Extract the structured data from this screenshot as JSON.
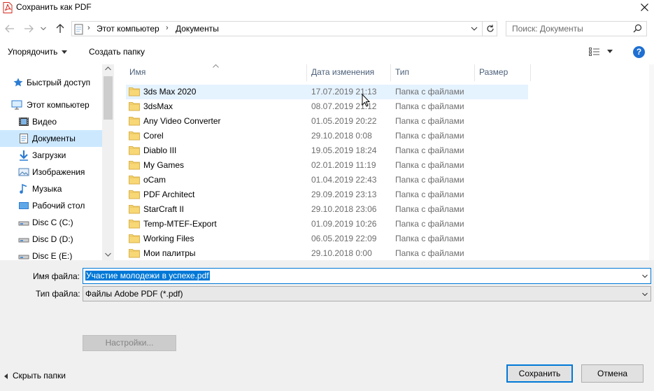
{
  "window": {
    "title": "Сохранить как PDF",
    "close_glyph": "✕"
  },
  "address": {
    "crumbs": [
      "Этот компьютер",
      "Документы"
    ],
    "separator": "›"
  },
  "search": {
    "placeholder": "Поиск: Документы"
  },
  "toolbar": {
    "organize": "Упорядочить",
    "new_folder": "Создать папку",
    "help": "?"
  },
  "sidebar": {
    "items": [
      {
        "label": "Быстрый доступ",
        "icon": "star-icon"
      },
      {
        "label": "Этот компьютер",
        "icon": "computer-icon"
      },
      {
        "label": "Видео",
        "icon": "video-icon"
      },
      {
        "label": "Документы",
        "icon": "documents-icon",
        "selected": true
      },
      {
        "label": "Загрузки",
        "icon": "download-icon"
      },
      {
        "label": "Изображения",
        "icon": "pictures-icon"
      },
      {
        "label": "Музыка",
        "icon": "music-icon"
      },
      {
        "label": "Рабочий стол",
        "icon": "desktop-icon"
      },
      {
        "label": "Disc C (C:)",
        "icon": "drive-icon"
      },
      {
        "label": "Disc D (D:)",
        "icon": "drive-icon"
      },
      {
        "label": "Disc E (E:)",
        "icon": "drive-icon"
      }
    ]
  },
  "columns": {
    "name": "Имя",
    "date": "Дата изменения",
    "type": "Тип",
    "size": "Размер"
  },
  "files": [
    {
      "name": "3ds Max 2020",
      "date": "17.07.2019 21:13",
      "type": "Папка с файлами"
    },
    {
      "name": "3dsMax",
      "date": "08.07.2019 21:12",
      "type": "Папка с файлами"
    },
    {
      "name": "Any Video Converter",
      "date": "01.05.2019 20:22",
      "type": "Папка с файлами"
    },
    {
      "name": "Corel",
      "date": "29.10.2018 0:08",
      "type": "Папка с файлами"
    },
    {
      "name": "Diablo III",
      "date": "19.05.2019 18:24",
      "type": "Папка с файлами"
    },
    {
      "name": "My Games",
      "date": "02.01.2019 11:19",
      "type": "Папка с файлами"
    },
    {
      "name": "oCam",
      "date": "01.04.2019 22:43",
      "type": "Папка с файлами"
    },
    {
      "name": "PDF Architect",
      "date": "29.09.2019 23:13",
      "type": "Папка с файлами"
    },
    {
      "name": "StarCraft II",
      "date": "29.10.2018 23:06",
      "type": "Папка с файлами"
    },
    {
      "name": "Temp-MTEF-Export",
      "date": "01.09.2019 10:26",
      "type": "Папка с файлами"
    },
    {
      "name": "Working Files",
      "date": "06.05.2019 22:09",
      "type": "Папка с файлами"
    },
    {
      "name": "Мои палитры",
      "date": "29.10.2018 0:00",
      "type": "Папка с файлами"
    }
  ],
  "form": {
    "filename_label": "Имя файла:",
    "filename_value": "Участие молодежи в успехе.pdf",
    "filetype_label": "Тип файла:",
    "filetype_value": "Файлы Adobe PDF (*.pdf)",
    "settings_button": "Настройки..."
  },
  "footer": {
    "hide_folders": "Скрыть папки",
    "save": "Сохранить",
    "cancel": "Отмена"
  },
  "colors": {
    "accent": "#0078d7",
    "selected_bg": "#cce8ff",
    "hover_bg": "#e5f3ff",
    "folder": "#f8d775"
  }
}
